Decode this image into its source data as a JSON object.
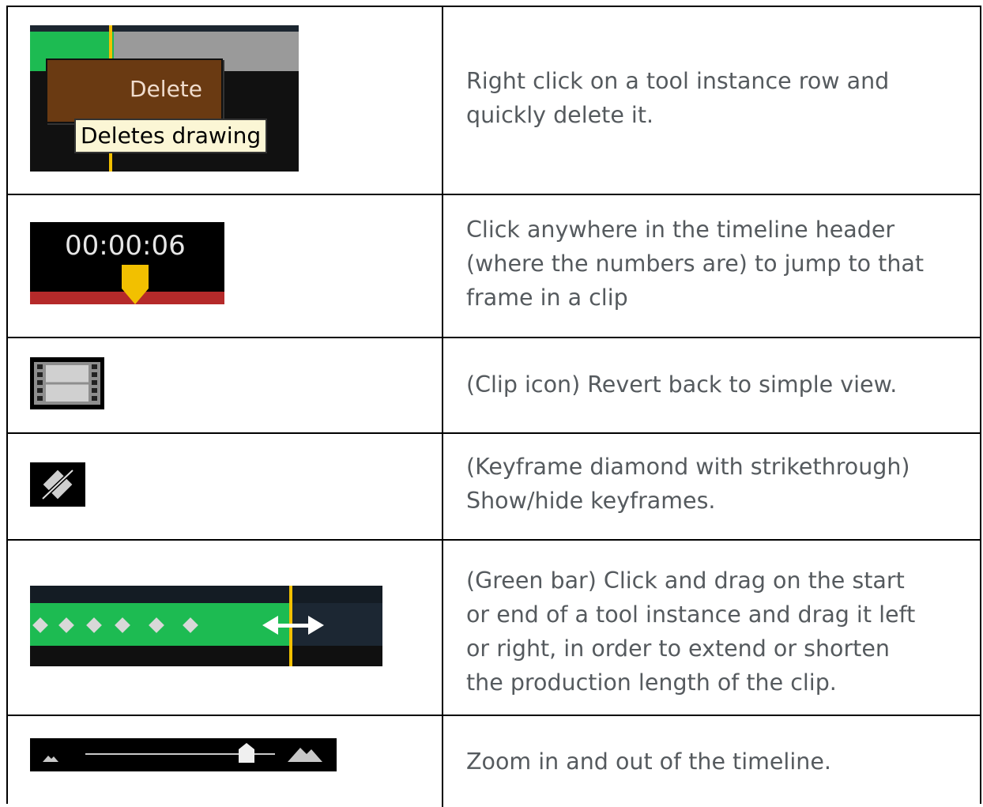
{
  "rows": [
    {
      "description": "Right click on a tool instance row and quickly delete it.",
      "menu_item": "Delete",
      "tooltip": "Deletes drawing",
      "icon": "context-menu"
    },
    {
      "description": "Click anywhere in the timeline header (where the numbers are) to jump to that frame in a clip",
      "timecode": "00:00:06",
      "icon": "playhead-marker"
    },
    {
      "description": "(Clip icon) Revert back to simple view.",
      "icon": "film-clip-icon"
    },
    {
      "description": "(Keyframe diamond with strikethrough) Show/hide keyframes.",
      "icon": "keyframe-strike-icon"
    },
    {
      "description": "(Green bar) Click and drag on the start or end of a tool instance and drag it left or right, in order to extend or shorten the production length of the clip.",
      "icon": "resize-arrow-icon"
    },
    {
      "description": "Zoom in and out of the timeline.",
      "icon": "zoom-slider-icon",
      "zoom_level": 0.85
    }
  ],
  "colors": {
    "text": "#555a5e",
    "clip_green": "#1dbb52",
    "playhead_yellow": "#f2c000",
    "timeline_red": "#b52a2a",
    "menu_brown": "#6a3a12"
  }
}
